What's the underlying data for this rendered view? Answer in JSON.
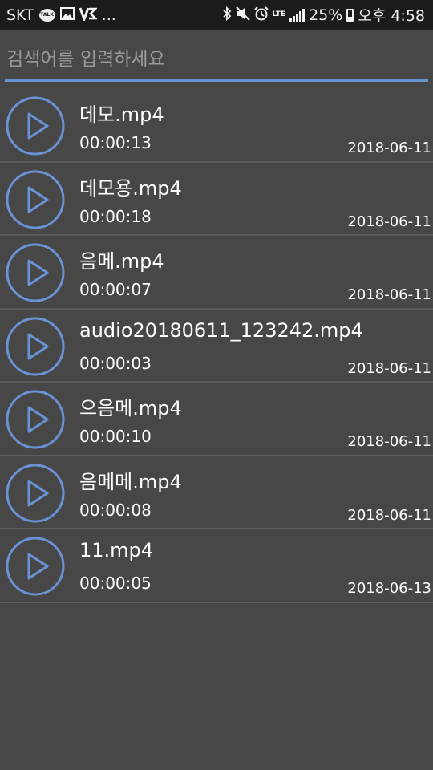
{
  "status_bar": {
    "carrier": "SKT",
    "talk_badge": "TALK",
    "overflow": "...",
    "network": "LTE",
    "battery": "25%",
    "time": "오후 4:58",
    "icons": [
      "kakaotalk-icon",
      "image-icon",
      "v3-icon",
      "bluetooth-icon",
      "mute-icon",
      "alarm-icon",
      "lte-icon",
      "signal-icon",
      "battery-icon"
    ]
  },
  "search": {
    "placeholder": "검색어를 입력하세요",
    "value": "",
    "accent_color": "#6a93d6"
  },
  "files": [
    {
      "name": "데모.mp4",
      "duration": "00:00:13",
      "date": "2018-06-11"
    },
    {
      "name": "데모용.mp4",
      "duration": "00:00:18",
      "date": "2018-06-11"
    },
    {
      "name": "음메.mp4",
      "duration": "00:00:07",
      "date": "2018-06-11"
    },
    {
      "name": "audio20180611_123242.mp4",
      "duration": "00:00:03",
      "date": "2018-06-11"
    },
    {
      "name": "으음메.mp4",
      "duration": "00:00:10",
      "date": "2018-06-11"
    },
    {
      "name": "음메메.mp4",
      "duration": "00:00:08",
      "date": "2018-06-11"
    },
    {
      "name": "11.mp4",
      "duration": "00:00:05",
      "date": "2018-06-13"
    }
  ],
  "colors": {
    "background": "#474747",
    "status_bar": "#1b1b1b",
    "play_icon": "#6a93d6",
    "divider": "#5c5c5c"
  }
}
